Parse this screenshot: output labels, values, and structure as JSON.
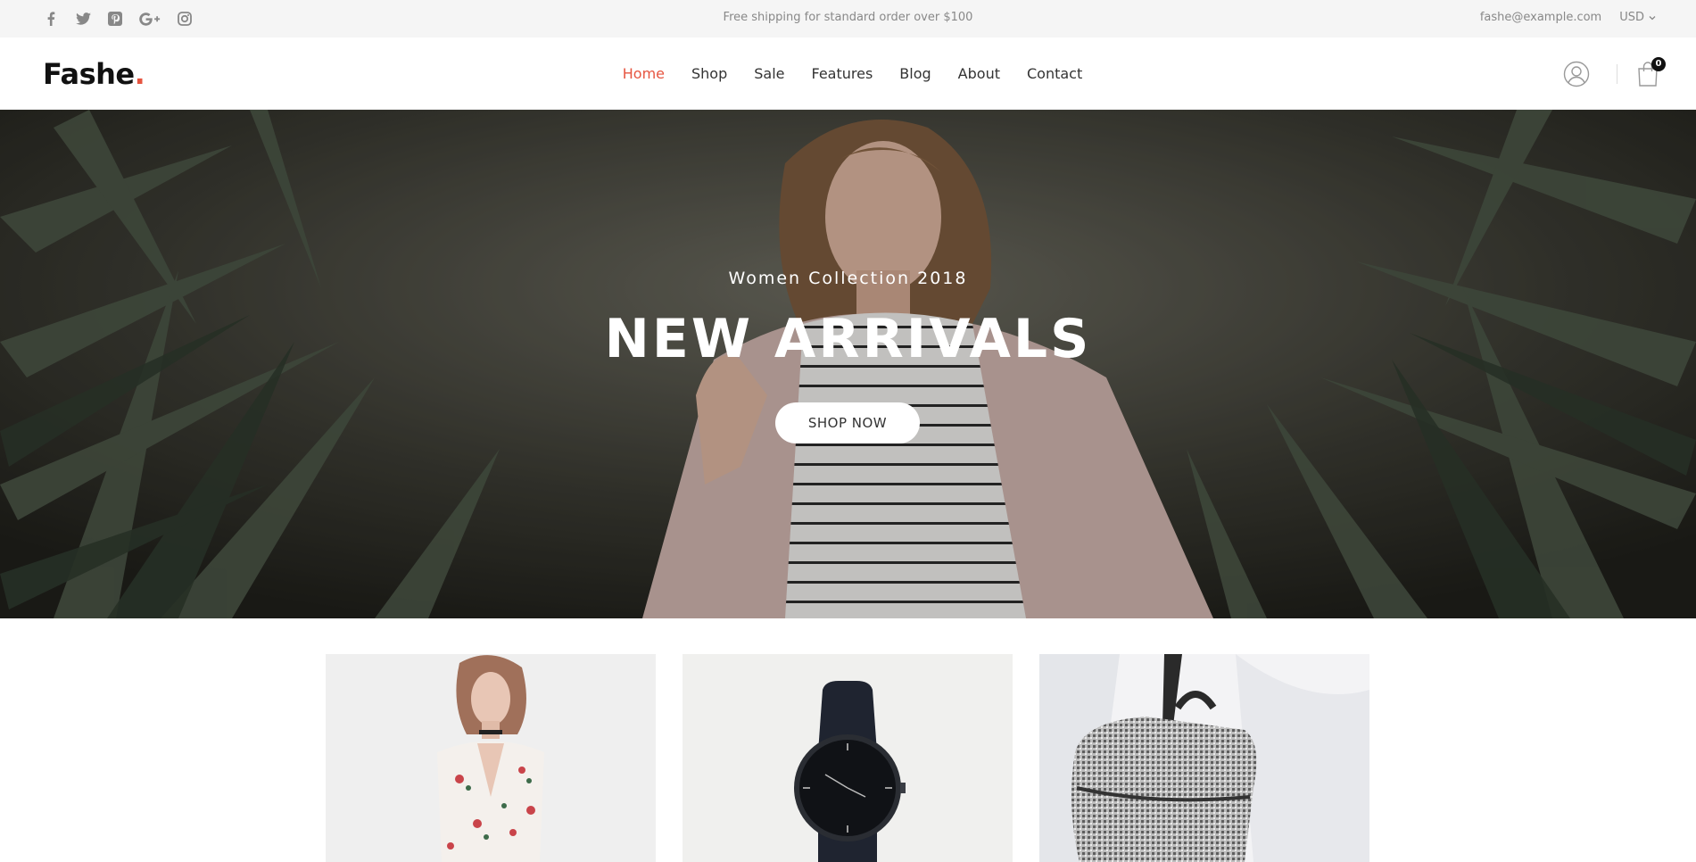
{
  "topbar": {
    "social": [
      "facebook-icon",
      "twitter-icon",
      "pinterest-icon",
      "google-plus-icon",
      "instagram-icon"
    ],
    "shipping_text": "Free shipping for standard order over $100",
    "email": "fashe@example.com",
    "currency": "USD"
  },
  "header": {
    "logo_text": "Fashe",
    "logo_dot": ".",
    "nav": [
      {
        "label": "Home",
        "active": true
      },
      {
        "label": "Shop"
      },
      {
        "label": "Sale"
      },
      {
        "label": "Features"
      },
      {
        "label": "Blog"
      },
      {
        "label": "About"
      },
      {
        "label": "Contact"
      }
    ],
    "cart_count": "0"
  },
  "hero": {
    "subtitle": "Women Collection 2018",
    "title": "NEW ARRIVALS",
    "button_label": "SHOP NOW"
  },
  "colors": {
    "accent": "#e65540",
    "topbar_bg": "#f5f5f5"
  },
  "products": [
    {
      "image": "floral-dress-image"
    },
    {
      "image": "black-watch-image"
    },
    {
      "image": "knit-backpack-image"
    }
  ]
}
